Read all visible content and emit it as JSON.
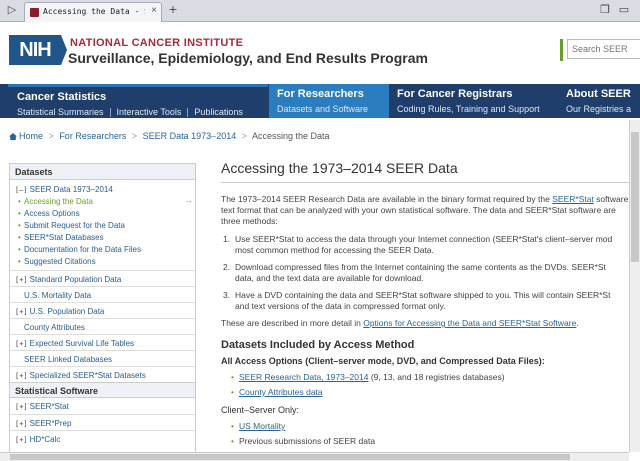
{
  "browser": {
    "tab_title": "Accessing the Data - SEER Da",
    "close_glyph": "×",
    "new_tab_glyph": "+"
  },
  "header": {
    "logo_text": "NIH",
    "institute": "NATIONAL CANCER INSTITUTE",
    "program": "Surveillance, Epidemiology, and End Results Program",
    "search_placeholder": "Search SEER"
  },
  "nav": {
    "cancer_stats": {
      "title": "Cancer Statistics",
      "subs": [
        "Statistical Summaries",
        "Interactive Tools",
        "Publications"
      ]
    },
    "researchers": {
      "title": "For Researchers",
      "sub": "Datasets and Software"
    },
    "registrars": {
      "title": "For Cancer Registrars",
      "sub": "Coding Rules, Training and Support"
    },
    "about": {
      "title": "About SEER",
      "sub": "Our Registries a"
    }
  },
  "breadcrumb": [
    "Home",
    "For Researchers",
    "SEER Data 1973–2014",
    "Accessing the Data"
  ],
  "sidebar": {
    "datasets_heading": "Datasets",
    "seer_data": "SEER Data 1973–2014",
    "seer_subs": [
      "Accessing the Data",
      "Access Options",
      "Submit Request for the Data",
      "SEER*Stat Databases",
      "Documentation for the Data Files",
      "Suggested Citations"
    ],
    "items": [
      "Standard Population Data",
      "U.S. Mortality Data",
      "U.S. Population Data",
      "County Attributes",
      "Expected Survival Life Tables",
      "SEER Linked Databases",
      "Specialized SEER*Stat Datasets"
    ],
    "software_heading": "Statistical Software",
    "software": [
      "SEER*Stat",
      "SEER*Prep",
      "HD*Calc"
    ],
    "toggle_open": "[–]",
    "toggle_closed": "[+]",
    "arrow": "→"
  },
  "main": {
    "title": "Accessing the 1973–2014 SEER Data",
    "intro_1a": "The 1973–2014 SEER Research Data are available in the binary format required by the ",
    "intro_link": "SEER*Stat",
    "intro_1b": " software",
    "intro_2": "text format that can be analyzed with your own statistical software. The data and SEER*Stat software are",
    "intro_3": "three methods:",
    "methods": [
      {
        "num": "1.",
        "l1": "Use SEER*Stat to access the data through your Internet connection (SEER*Stat's client–server mod",
        "l2": "most common method for accessing the SEER Data."
      },
      {
        "num": "2.",
        "l1": "Download compressed files from the Internet containing the same contents as the DVDs. SEER*St",
        "l2": "data, and the text data are available for download."
      },
      {
        "num": "3.",
        "l1": "Have a DVD containing the data and SEER*Stat software shipped to you. This will contain SEER*St",
        "l2": "and text versions of the data in compressed format only."
      }
    ],
    "detail_a": "These are described in more detail in ",
    "detail_link": "Options for Accessing the Data and SEER*Stat Software",
    "detail_b": ".",
    "datasets_heading": "Datasets Included by Access Method",
    "all_access": "All Access Options (Client–server mode, DVD, and Compressed Data Files):",
    "all_items": [
      {
        "link": "SEER Research Data, 1973–2014",
        "rest": " (9, 13, and 18 registries databases)"
      },
      {
        "link": "County Attributes data",
        "rest": ""
      }
    ],
    "client_server": "Client–Server Only:",
    "cs_items": [
      {
        "link": "US Mortality",
        "rest": ""
      },
      {
        "link": "",
        "rest": "Previous submissions of SEER data"
      }
    ]
  }
}
